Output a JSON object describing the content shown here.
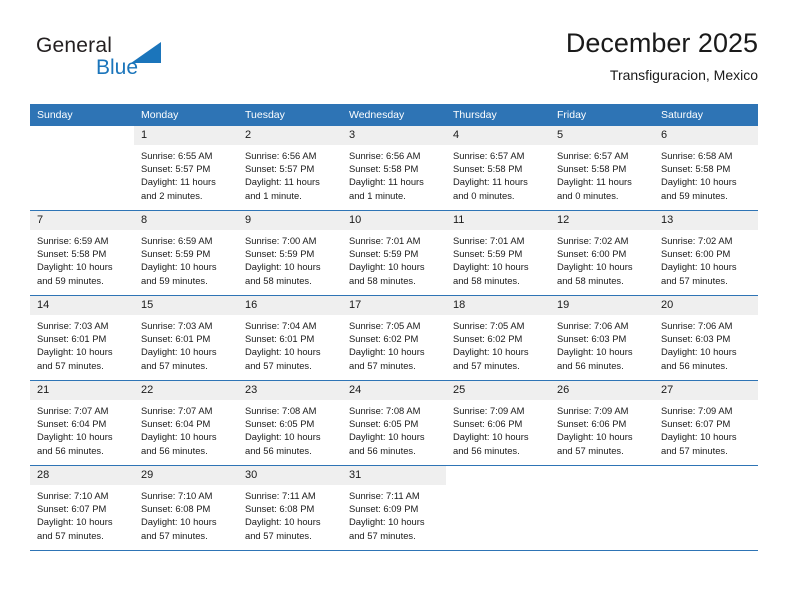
{
  "brand": {
    "name_part1": "General",
    "name_part2": "Blue",
    "accent_color": "#1b75bb",
    "triangle_icon": "triangle-logo-icon"
  },
  "header": {
    "title": "December 2025",
    "subtitle": "Transfiguracion, Mexico"
  },
  "calendar": {
    "header_color": "#2e74b5",
    "daynum_band_color": "#efefef",
    "weekdays": [
      "Sunday",
      "Monday",
      "Tuesday",
      "Wednesday",
      "Thursday",
      "Friday",
      "Saturday"
    ],
    "weeks": [
      [
        {
          "day": "",
          "sunrise": "",
          "sunset": "",
          "daylight": "",
          "empty": true
        },
        {
          "day": "1",
          "sunrise": "Sunrise: 6:55 AM",
          "sunset": "Sunset: 5:57 PM",
          "daylight": "Daylight: 11 hours and 2 minutes."
        },
        {
          "day": "2",
          "sunrise": "Sunrise: 6:56 AM",
          "sunset": "Sunset: 5:57 PM",
          "daylight": "Daylight: 11 hours and 1 minute."
        },
        {
          "day": "3",
          "sunrise": "Sunrise: 6:56 AM",
          "sunset": "Sunset: 5:58 PM",
          "daylight": "Daylight: 11 hours and 1 minute."
        },
        {
          "day": "4",
          "sunrise": "Sunrise: 6:57 AM",
          "sunset": "Sunset: 5:58 PM",
          "daylight": "Daylight: 11 hours and 0 minutes."
        },
        {
          "day": "5",
          "sunrise": "Sunrise: 6:57 AM",
          "sunset": "Sunset: 5:58 PM",
          "daylight": "Daylight: 11 hours and 0 minutes."
        },
        {
          "day": "6",
          "sunrise": "Sunrise: 6:58 AM",
          "sunset": "Sunset: 5:58 PM",
          "daylight": "Daylight: 10 hours and 59 minutes."
        }
      ],
      [
        {
          "day": "7",
          "sunrise": "Sunrise: 6:59 AM",
          "sunset": "Sunset: 5:58 PM",
          "daylight": "Daylight: 10 hours and 59 minutes."
        },
        {
          "day": "8",
          "sunrise": "Sunrise: 6:59 AM",
          "sunset": "Sunset: 5:59 PM",
          "daylight": "Daylight: 10 hours and 59 minutes."
        },
        {
          "day": "9",
          "sunrise": "Sunrise: 7:00 AM",
          "sunset": "Sunset: 5:59 PM",
          "daylight": "Daylight: 10 hours and 58 minutes."
        },
        {
          "day": "10",
          "sunrise": "Sunrise: 7:01 AM",
          "sunset": "Sunset: 5:59 PM",
          "daylight": "Daylight: 10 hours and 58 minutes."
        },
        {
          "day": "11",
          "sunrise": "Sunrise: 7:01 AM",
          "sunset": "Sunset: 5:59 PM",
          "daylight": "Daylight: 10 hours and 58 minutes."
        },
        {
          "day": "12",
          "sunrise": "Sunrise: 7:02 AM",
          "sunset": "Sunset: 6:00 PM",
          "daylight": "Daylight: 10 hours and 58 minutes."
        },
        {
          "day": "13",
          "sunrise": "Sunrise: 7:02 AM",
          "sunset": "Sunset: 6:00 PM",
          "daylight": "Daylight: 10 hours and 57 minutes."
        }
      ],
      [
        {
          "day": "14",
          "sunrise": "Sunrise: 7:03 AM",
          "sunset": "Sunset: 6:01 PM",
          "daylight": "Daylight: 10 hours and 57 minutes."
        },
        {
          "day": "15",
          "sunrise": "Sunrise: 7:03 AM",
          "sunset": "Sunset: 6:01 PM",
          "daylight": "Daylight: 10 hours and 57 minutes."
        },
        {
          "day": "16",
          "sunrise": "Sunrise: 7:04 AM",
          "sunset": "Sunset: 6:01 PM",
          "daylight": "Daylight: 10 hours and 57 minutes."
        },
        {
          "day": "17",
          "sunrise": "Sunrise: 7:05 AM",
          "sunset": "Sunset: 6:02 PM",
          "daylight": "Daylight: 10 hours and 57 minutes."
        },
        {
          "day": "18",
          "sunrise": "Sunrise: 7:05 AM",
          "sunset": "Sunset: 6:02 PM",
          "daylight": "Daylight: 10 hours and 57 minutes."
        },
        {
          "day": "19",
          "sunrise": "Sunrise: 7:06 AM",
          "sunset": "Sunset: 6:03 PM",
          "daylight": "Daylight: 10 hours and 56 minutes."
        },
        {
          "day": "20",
          "sunrise": "Sunrise: 7:06 AM",
          "sunset": "Sunset: 6:03 PM",
          "daylight": "Daylight: 10 hours and 56 minutes."
        }
      ],
      [
        {
          "day": "21",
          "sunrise": "Sunrise: 7:07 AM",
          "sunset": "Sunset: 6:04 PM",
          "daylight": "Daylight: 10 hours and 56 minutes."
        },
        {
          "day": "22",
          "sunrise": "Sunrise: 7:07 AM",
          "sunset": "Sunset: 6:04 PM",
          "daylight": "Daylight: 10 hours and 56 minutes."
        },
        {
          "day": "23",
          "sunrise": "Sunrise: 7:08 AM",
          "sunset": "Sunset: 6:05 PM",
          "daylight": "Daylight: 10 hours and 56 minutes."
        },
        {
          "day": "24",
          "sunrise": "Sunrise: 7:08 AM",
          "sunset": "Sunset: 6:05 PM",
          "daylight": "Daylight: 10 hours and 56 minutes."
        },
        {
          "day": "25",
          "sunrise": "Sunrise: 7:09 AM",
          "sunset": "Sunset: 6:06 PM",
          "daylight": "Daylight: 10 hours and 56 minutes."
        },
        {
          "day": "26",
          "sunrise": "Sunrise: 7:09 AM",
          "sunset": "Sunset: 6:06 PM",
          "daylight": "Daylight: 10 hours and 57 minutes."
        },
        {
          "day": "27",
          "sunrise": "Sunrise: 7:09 AM",
          "sunset": "Sunset: 6:07 PM",
          "daylight": "Daylight: 10 hours and 57 minutes."
        }
      ],
      [
        {
          "day": "28",
          "sunrise": "Sunrise: 7:10 AM",
          "sunset": "Sunset: 6:07 PM",
          "daylight": "Daylight: 10 hours and 57 minutes."
        },
        {
          "day": "29",
          "sunrise": "Sunrise: 7:10 AM",
          "sunset": "Sunset: 6:08 PM",
          "daylight": "Daylight: 10 hours and 57 minutes."
        },
        {
          "day": "30",
          "sunrise": "Sunrise: 7:11 AM",
          "sunset": "Sunset: 6:08 PM",
          "daylight": "Daylight: 10 hours and 57 minutes."
        },
        {
          "day": "31",
          "sunrise": "Sunrise: 7:11 AM",
          "sunset": "Sunset: 6:09 PM",
          "daylight": "Daylight: 10 hours and 57 minutes."
        },
        {
          "day": "",
          "sunrise": "",
          "sunset": "",
          "daylight": "",
          "empty": true
        },
        {
          "day": "",
          "sunrise": "",
          "sunset": "",
          "daylight": "",
          "empty": true
        },
        {
          "day": "",
          "sunrise": "",
          "sunset": "",
          "daylight": "",
          "empty": true
        }
      ]
    ]
  }
}
